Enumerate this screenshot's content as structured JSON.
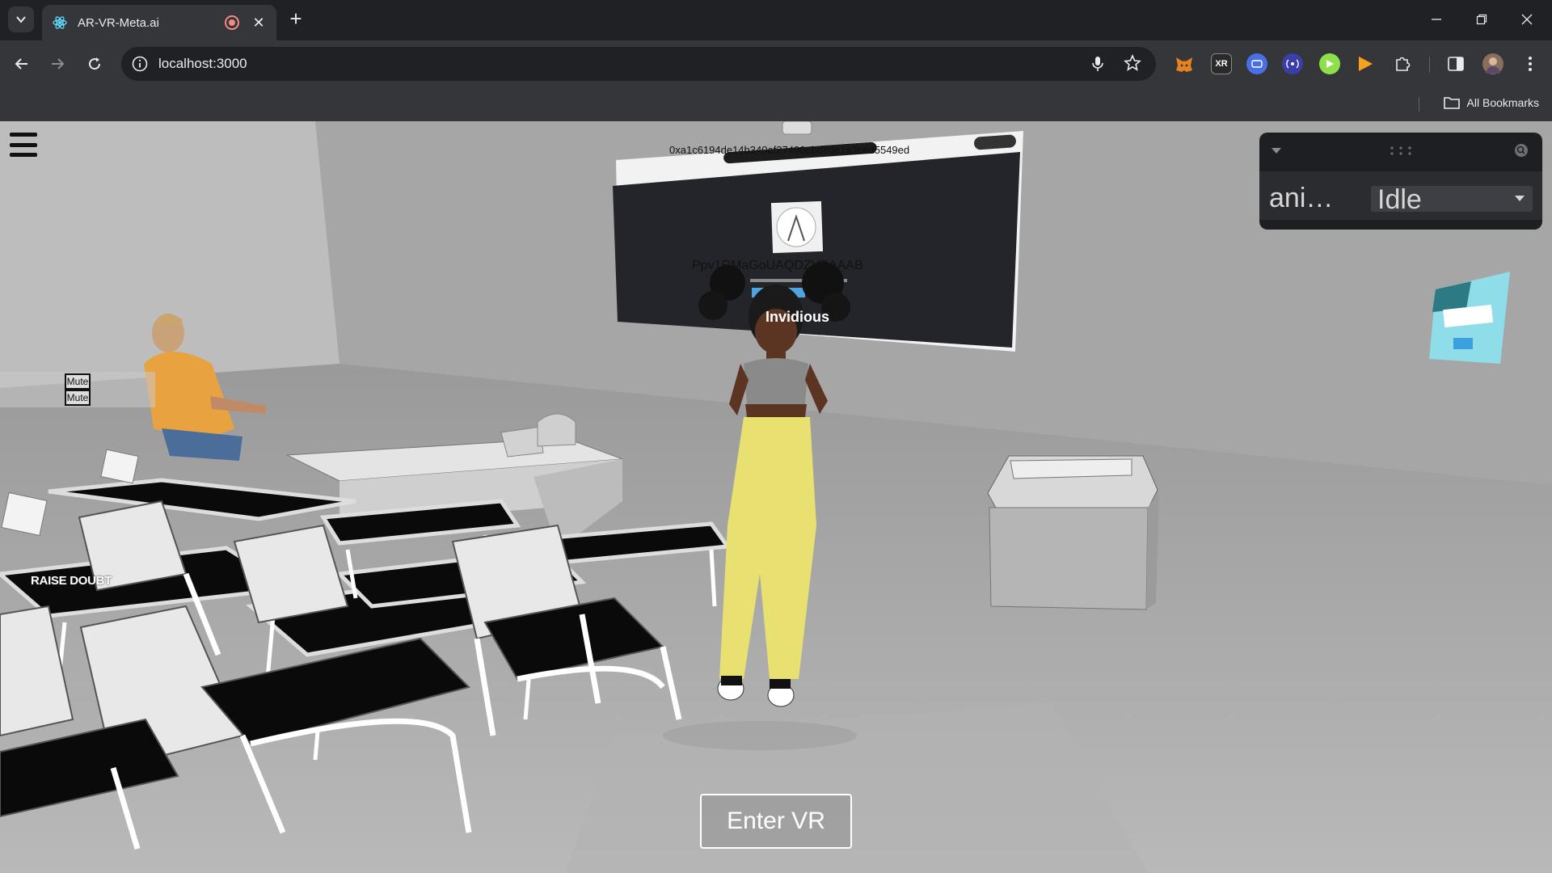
{
  "browser": {
    "tab_title": "AR-VR-Meta.ai",
    "new_tab_label": "+",
    "url": "localhost:3000",
    "bookmarks_label": "All Bookmarks",
    "extensions": [
      "metamask-icon",
      "webxr-icon",
      "ext-icon",
      "broadcast-icon",
      "play-green-icon",
      "play-orange-icon",
      "puzzle-icon"
    ]
  },
  "scene": {
    "wallet_address": "0xa1c6194de14b340af27490ebd80c1a3ced5549ed",
    "screen_overlay_text": "Ppv1RMaGoUAQDZVBAAAB",
    "screen_title": "Invidious",
    "mute_buttons": [
      "Mute",
      "Mute"
    ],
    "raise_doubt_label": "RAISE DOUBT",
    "enter_vr_label": "Enter VR"
  },
  "gui": {
    "anim_label": "ani…",
    "anim_value": "Idle"
  },
  "colors": {
    "chrome_bg": "#202124",
    "toolbar_bg": "#35363a",
    "scene_bg": "#a9a9a9",
    "gui_bg": "#1e1f22"
  }
}
